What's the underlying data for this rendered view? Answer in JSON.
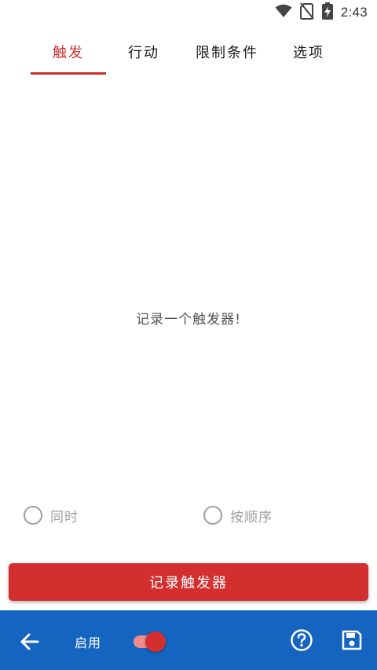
{
  "status_bar": {
    "time": "2:43"
  },
  "tabs": [
    {
      "label": "触发"
    },
    {
      "label": "行动"
    },
    {
      "label": "限制条件"
    },
    {
      "label": "选项"
    }
  ],
  "active_tab": "触发",
  "main": {
    "empty_message": "记录一个触发器!"
  },
  "radios": [
    {
      "label": "同时",
      "selected": false
    },
    {
      "label": "按顺序",
      "selected": false
    }
  ],
  "record_button": {
    "label": "记录触发器"
  },
  "bottom_bar": {
    "enable_label": "启用",
    "enabled": true
  },
  "colors": {
    "accent": "#d32f2f",
    "bar": "#1565c0",
    "toggle_track": "#f08c8c"
  },
  "icons": [
    "wifi-icon",
    "no-sim-icon",
    "battery-charging-icon",
    "back-arrow-icon",
    "help-icon",
    "save-icon"
  ]
}
